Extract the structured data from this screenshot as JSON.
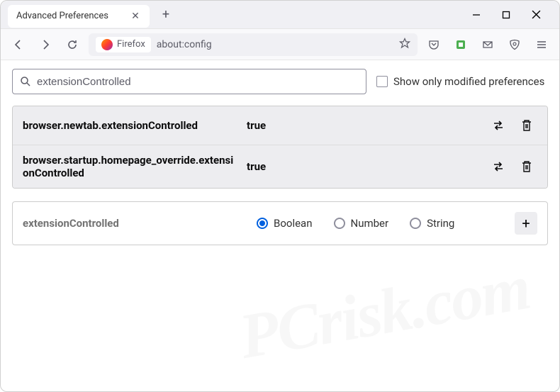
{
  "window": {
    "tab_title": "Advanced Preferences"
  },
  "urlbar": {
    "firefox_label": "Firefox",
    "url": "about:config"
  },
  "search": {
    "value": "extensionControlled",
    "checkbox_label": "Show only modified preferences"
  },
  "prefs": [
    {
      "name": "browser.newtab.extensionControlled",
      "value": "true"
    },
    {
      "name": "browser.startup.homepage_override.extensionControlled",
      "value": "true"
    }
  ],
  "add": {
    "name": "extensionControlled",
    "options": {
      "boolean": "Boolean",
      "number": "Number",
      "string": "String"
    }
  },
  "watermark": "PCrisk.com"
}
